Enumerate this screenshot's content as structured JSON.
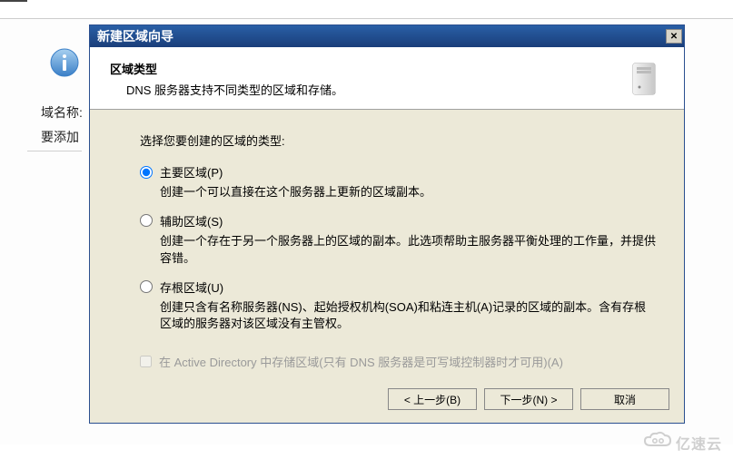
{
  "background": {
    "label1": "域名称:",
    "label2": "要添加"
  },
  "dialog": {
    "title": "新建区域向导",
    "header": {
      "title": "区域类型",
      "subtitle": "DNS 服务器支持不同类型的区域和存储。"
    },
    "prompt": "选择您要创建的区域的类型:",
    "options": {
      "primary": {
        "label": "主要区域(P)",
        "desc": "创建一个可以直接在这个服务器上更新的区域副本。",
        "checked": true
      },
      "secondary": {
        "label": "辅助区域(S)",
        "desc": "创建一个存在于另一个服务器上的区域的副本。此选项帮助主服务器平衡处理的工作量，并提供容错。",
        "checked": false
      },
      "stub": {
        "label": "存根区域(U)",
        "desc": "创建只含有名称服务器(NS)、起始授权机构(SOA)和粘连主机(A)记录的区域的副本。含有存根区域的服务器对该区域没有主管权。",
        "checked": false
      }
    },
    "ad_checkbox": {
      "label": "在 Active Directory 中存储区域(只有 DNS 服务器是可写域控制器时才可用)(A)",
      "disabled": true
    },
    "buttons": {
      "back": "< 上一步(B)",
      "next": "下一步(N) >",
      "cancel": "取消"
    }
  },
  "watermark": "亿速云"
}
